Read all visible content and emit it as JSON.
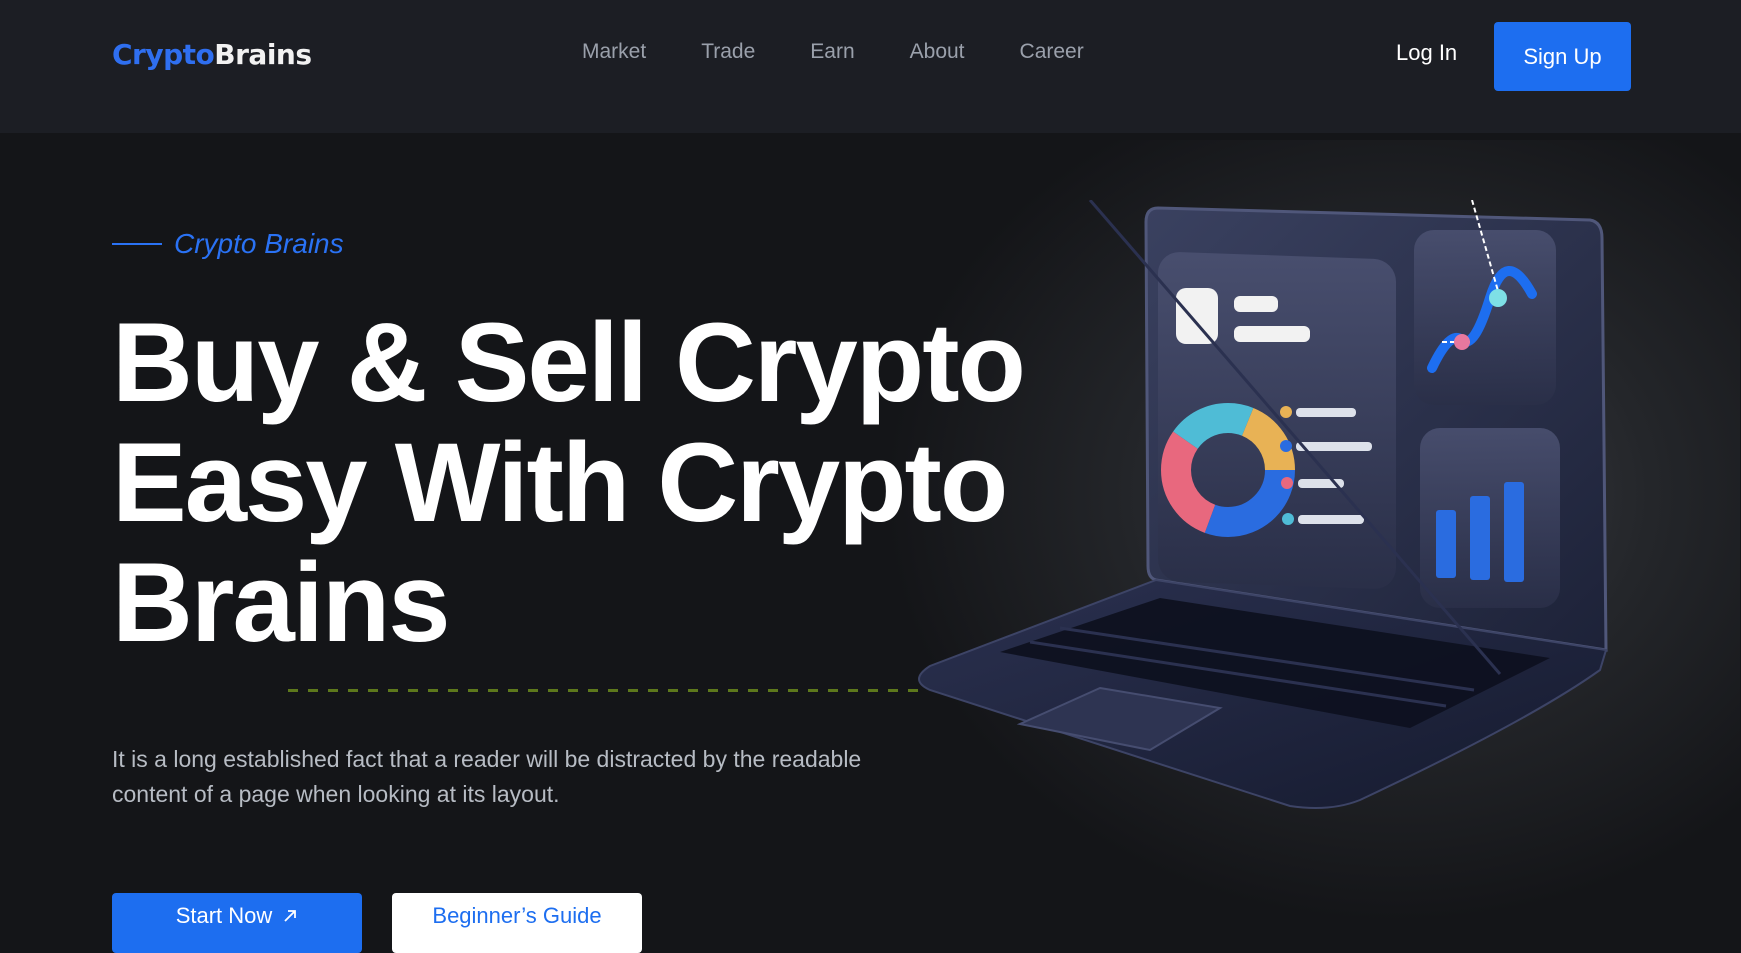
{
  "header": {
    "logo_part1": "Crypto",
    "logo_part2": "Brains",
    "nav": [
      "Market",
      "Trade",
      "Earn",
      "About",
      "Career"
    ],
    "login_label": "Log In",
    "signup_label": "Sign Up"
  },
  "hero": {
    "eyebrow": "Crypto Brains",
    "headline_line1": "Buy & Sell Crypto",
    "headline_line2": "Easy With Crypto",
    "headline_line3": "Brains",
    "description": "It is a long established fact that a reader will be distracted by the readable content of a page when looking at its layout.",
    "start_label": "Start Now",
    "guide_label": "Beginner’s Guide",
    "start_icon": "arrow-up-right-icon"
  },
  "colors": {
    "accent": "#1d6ef0",
    "background": "#141518",
    "header_bg": "#1c1e24"
  }
}
